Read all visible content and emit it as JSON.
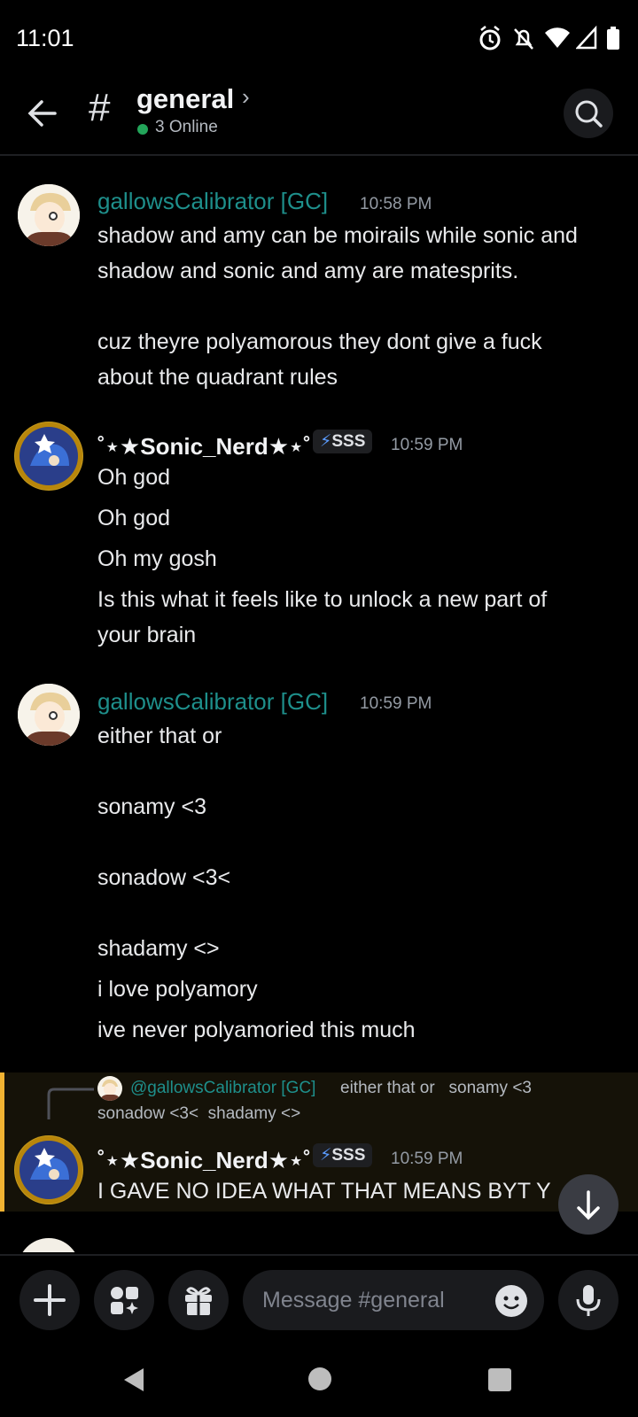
{
  "status_bar": {
    "time": "11:01"
  },
  "header": {
    "channel_name": "general",
    "online_count": "3 Online"
  },
  "messages": [
    {
      "author": "gallowsCalibrator [GC]",
      "timestamp": "10:58 PM",
      "lines": [
        "shadow and amy can be moirails while sonic and",
        "shadow and sonic and amy are matesprits.",
        "cuz theyre polyamorous they dont give a fuck",
        "about the quadrant rules"
      ]
    },
    {
      "author": "˚⋆★Sonic_Nerd★⋆˚",
      "tag": "SSS",
      "timestamp": "10:59 PM",
      "lines": [
        "Oh god",
        "Oh god",
        "Oh my gosh",
        "Is this what it feels like to unlock a new part of",
        "your brain"
      ]
    },
    {
      "author": "gallowsCalibrator [GC]",
      "timestamp": "10:59 PM",
      "lines": [
        "either that or",
        "sonamy <3",
        "sonadow <3<",
        "shadamy <>",
        "i love polyamory",
        "ive never polyamoried this much"
      ]
    },
    {
      "reply_to_author": "@gallowsCalibrator [GC]",
      "reply_to_text_1": "either that or   sonamy <3",
      "reply_to_text_2": "sonadow <3<  shadamy <>",
      "author": "˚⋆★Sonic_Nerd★⋆˚",
      "tag": "SSS",
      "timestamp": "10:59 PM",
      "lines": [
        "I GAVE NO IDEA WHAT THAT MEANS BYT Y"
      ]
    }
  ],
  "composer": {
    "placeholder": "Message #general"
  },
  "icons": {
    "back": "arrow-left-icon",
    "search": "search-icon",
    "add": "plus-icon",
    "apps": "apps-icon",
    "gift": "gift-icon",
    "emoji": "emoji-icon",
    "mic": "microphone-icon"
  },
  "colors": {
    "gc_name": "#1e8f8b",
    "online": "#23a55a",
    "reply_accent": "#f0b232"
  }
}
